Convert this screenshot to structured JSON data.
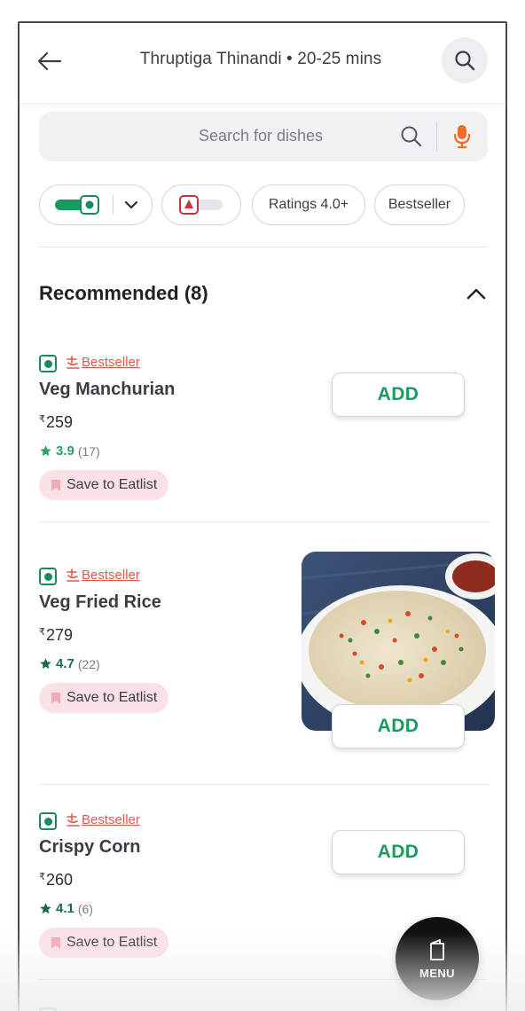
{
  "header": {
    "title": "Thruptiga Thinandi • 20-25 mins",
    "back_icon": "arrow-left-icon",
    "search_icon": "search-icon"
  },
  "search": {
    "placeholder": "Search for dishes",
    "search_icon": "search-icon",
    "mic_icon": "microphone-icon",
    "mic_color": "#e8702a"
  },
  "filters": {
    "veg_toggle_on": true,
    "nonveg_toggle_on": false,
    "ratings_label": "Ratings 4.0+",
    "bestseller_label": "Bestseller"
  },
  "section": {
    "title": "Recommended (8)",
    "collapse_icon": "chevron-up-icon"
  },
  "items": [
    {
      "tag": "Bestseller",
      "name": "Veg Manchurian",
      "currency": "₹",
      "price": "259",
      "rating": "3.9",
      "rating_count": "(17)",
      "eatlist_label": "Save to Eatlist",
      "add_label": "ADD",
      "has_image": false
    },
    {
      "tag": "Bestseller",
      "name": "Veg Fried Rice",
      "currency": "₹",
      "price": "279",
      "rating": "4.7",
      "rating_count": "(22)",
      "eatlist_label": "Save to Eatlist",
      "add_label": "ADD",
      "has_image": true
    },
    {
      "tag": "Bestseller",
      "name": "Crispy Corn",
      "currency": "₹",
      "price": "260",
      "rating": "4.1",
      "rating_count": "(6)",
      "eatlist_label": "Save to Eatlist",
      "add_label": "ADD",
      "has_image": false
    }
  ],
  "menu_fab": {
    "label": "MENU",
    "icon": "book-icon"
  },
  "colors": {
    "veg_green": "#1b8a5a",
    "add_green": "#1b9a5f",
    "rating_green_light": "#2aa168",
    "rating_green_dark": "#1a6b45",
    "bestseller_red": "#e2574c",
    "eatlist_bg": "#fbe1e6"
  }
}
